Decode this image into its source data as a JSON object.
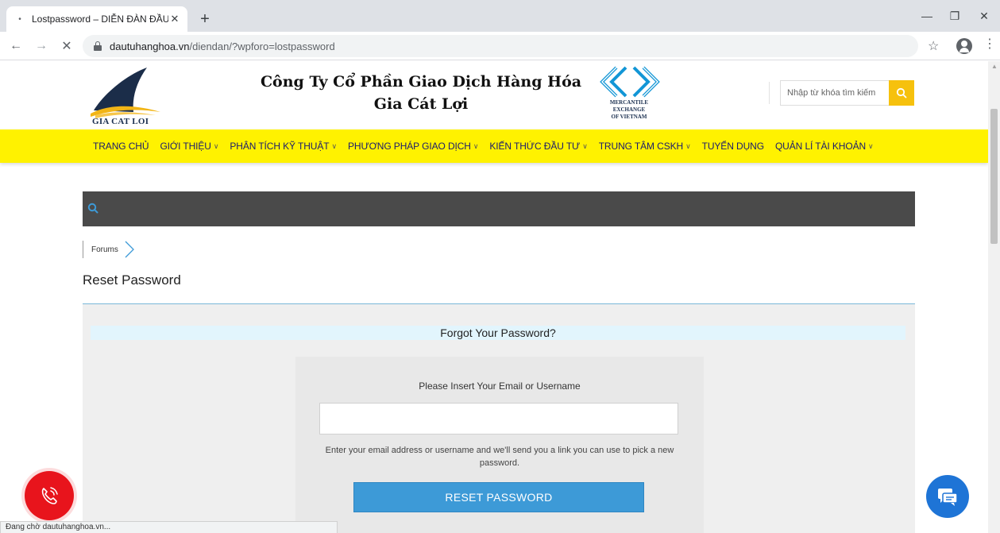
{
  "browser": {
    "tab_title": "Lostpassword – DIỄN ĐÀN ĐẦU T",
    "tab_close": "✕",
    "new_tab": "+",
    "url_host": "dautuhanghoa.vn",
    "url_path": "/diendan/?wpforo=lostpassword",
    "status_text": "Đang chờ dautuhanghoa.vn..."
  },
  "header": {
    "logo_text": "GIA CAT LOI",
    "company_line1": "Công Ty Cổ Phần Giao Dịch Hàng Hóa",
    "company_line2": "Gia Cát Lợi",
    "mxv_line1": "MERCANTILE",
    "mxv_line2": "EXCHANGE",
    "mxv_line3": "OF VIETNAM",
    "search_placeholder": "Nhập từ khóa tìm kiếm"
  },
  "nav": {
    "items": [
      {
        "label": "TRANG CHỦ",
        "dropdown": false
      },
      {
        "label": "GIỚI THIỆU",
        "dropdown": true
      },
      {
        "label": "PHÂN TÍCH KỸ THUẬT",
        "dropdown": true
      },
      {
        "label": "PHƯƠNG PHÁP GIAO DỊCH",
        "dropdown": true
      },
      {
        "label": "KIẾN THỨC ĐẦU TƯ",
        "dropdown": true
      },
      {
        "label": "TRUNG TÂM CSKH",
        "dropdown": true
      },
      {
        "label": "TUYỂN DỤNG",
        "dropdown": false
      },
      {
        "label": "QUẢN LÍ TÀI KHOẢN",
        "dropdown": true
      }
    ]
  },
  "breadcrumb": {
    "items": [
      "Forums"
    ]
  },
  "page": {
    "title": "Reset Password",
    "form_heading": "Forgot Your Password?",
    "field_label": "Please Insert Your Email or Username",
    "field_value": "",
    "help_text": "Enter your email address or username and we'll send you a link you can use to pick a new password.",
    "submit_label": "RESET PASSWORD"
  },
  "colors": {
    "nav_bg": "#fff200",
    "button_blue": "#3d9ad7",
    "call_red": "#e8141c",
    "chat_blue": "#1e74d6",
    "search_yellow": "#f6c10d"
  },
  "icons": {
    "favicon": "loading-dot-icon",
    "back": "arrow-left-icon",
    "forward": "arrow-right-icon",
    "stop": "close-icon",
    "lock": "lock-icon",
    "bookmark": "star-icon",
    "profile": "account-circle-icon",
    "menu": "kebab-menu-icon",
    "search": "search-icon",
    "call": "phone-icon",
    "chat": "chat-bubble-icon"
  }
}
